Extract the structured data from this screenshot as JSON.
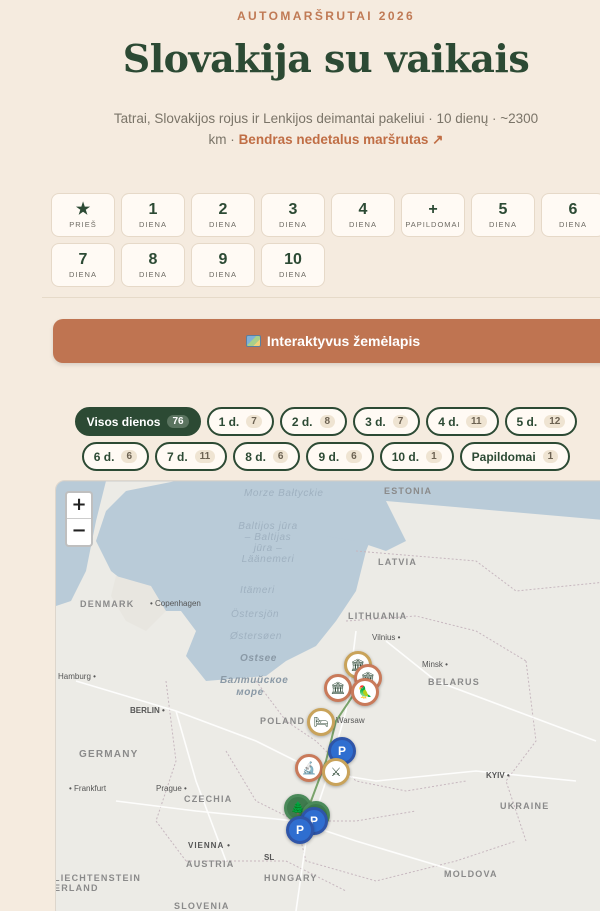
{
  "header": {
    "eyebrow": "AUTOMARŠRUTAI 2026",
    "title": "Slovakija su vaikais",
    "subtitle": "Tatrai, Slovakijos rojus ir Lenkijos deimantai pakeliui · 10 dienų · ~2300 km ·",
    "route_link": "Bendras nedetalus maršrutas ↗"
  },
  "day_buttons": [
    {
      "num": "★",
      "label": "PRIEŠ"
    },
    {
      "num": "1",
      "label": "DIENA"
    },
    {
      "num": "2",
      "label": "DIENA"
    },
    {
      "num": "3",
      "label": "DIENA"
    },
    {
      "num": "4",
      "label": "DIENA"
    },
    {
      "num": "+",
      "label": "PAPILDOMAI"
    },
    {
      "num": "5",
      "label": "DIENA"
    },
    {
      "num": "6",
      "label": "DIENA"
    },
    {
      "num": "7",
      "label": "DIENA"
    },
    {
      "num": "8",
      "label": "DIENA"
    },
    {
      "num": "9",
      "label": "DIENA"
    },
    {
      "num": "10",
      "label": "DIENA"
    }
  ],
  "map_button": {
    "label": "Interaktyvus žemėlapis",
    "icon": "map-icon"
  },
  "filters_row1": [
    {
      "label": "Visos dienos",
      "count": "76",
      "active": true
    },
    {
      "label": "1 d.",
      "count": "7"
    },
    {
      "label": "2 d.",
      "count": "8"
    },
    {
      "label": "3 d.",
      "count": "7"
    },
    {
      "label": "4 d.",
      "count": "11"
    },
    {
      "label": "5 d.",
      "count": "12"
    }
  ],
  "filters_row2": [
    {
      "label": "6 d.",
      "count": "6"
    },
    {
      "label": "7 d.",
      "count": "11"
    },
    {
      "label": "8 d.",
      "count": "6"
    },
    {
      "label": "9 d.",
      "count": "6"
    },
    {
      "label": "10 d.",
      "count": "1"
    },
    {
      "label": "Papildomai",
      "count": "1"
    }
  ],
  "map": {
    "zoom_in": "+",
    "zoom_out": "−",
    "seas": [
      "Morze Bałtyckie",
      "Baltijos jūra – Baltijas jūra – Läänemeri",
      "Itämeri",
      "Östersjön",
      "Østersøen",
      "Ostsee",
      "Балтийское море"
    ],
    "countries": [
      "ESTONIA",
      "LATVIA",
      "LITHUANIA",
      "DENMARK",
      "BELARUS",
      "POLAND",
      "GERMANY",
      "CZECHIA",
      "UKRAINE",
      "AUSTRIA",
      "HUNGARY",
      "MOLDOVA",
      "LIECHTENSTEIN",
      "ERLAND",
      "SLOVENIA"
    ],
    "cities": [
      "Copenhagen",
      "Vilnius",
      "Minsk",
      "Hamburg",
      "BERLIN",
      "Warsaw",
      "Prague",
      "Frankfurt",
      "VIENNA",
      "KYIV",
      "SL"
    ],
    "parking": "P"
  }
}
